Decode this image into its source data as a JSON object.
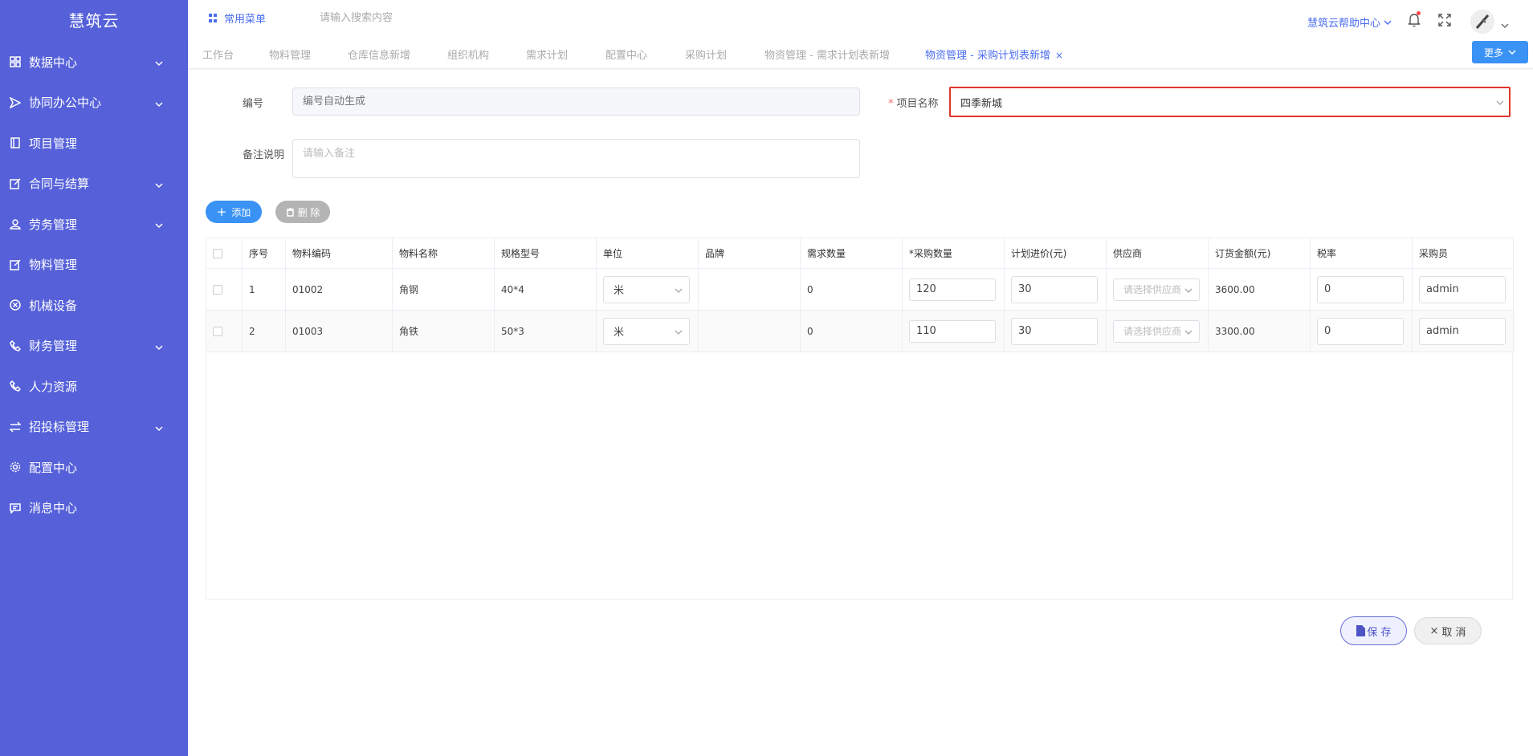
{
  "app": {
    "title": "慧筑云"
  },
  "sidebar": {
    "items": [
      {
        "label": "数据中心",
        "icon": "grid-icon",
        "expandable": true
      },
      {
        "label": "协同办公中心",
        "icon": "send-icon",
        "expandable": true
      },
      {
        "label": "项目管理",
        "icon": "book-icon",
        "expandable": false
      },
      {
        "label": "合同与结算",
        "icon": "edit-icon",
        "expandable": true
      },
      {
        "label": "劳务管理",
        "icon": "user-icon",
        "expandable": true
      },
      {
        "label": "物料管理",
        "icon": "edit-icon",
        "expandable": false
      },
      {
        "label": "机械设备",
        "icon": "circle-x-icon",
        "expandable": false
      },
      {
        "label": "财务管理",
        "icon": "phone-icon",
        "expandable": true
      },
      {
        "label": "人力资源",
        "icon": "phone-icon",
        "expandable": false
      },
      {
        "label": "招投标管理",
        "icon": "swap-icon",
        "expandable": true
      },
      {
        "label": "配置中心",
        "icon": "gear-icon",
        "expandable": false
      },
      {
        "label": "消息中心",
        "icon": "message-icon",
        "expandable": false
      }
    ]
  },
  "topbar": {
    "favorites_label": "常用菜单",
    "search_placeholder": "请输入搜索内容",
    "help_label": "慧筑云帮助中心"
  },
  "tabs": [
    {
      "label": "工作台",
      "active": false
    },
    {
      "label": "物料管理",
      "active": false
    },
    {
      "label": "仓库信息新增",
      "active": false
    },
    {
      "label": "组织机构",
      "active": false
    },
    {
      "label": "需求计划",
      "active": false
    },
    {
      "label": "配置中心",
      "active": false
    },
    {
      "label": "采购计划",
      "active": false
    },
    {
      "label": "物资管理 - 需求计划表新增",
      "active": false
    },
    {
      "label": "物资管理 - 采购计划表新增",
      "active": true
    }
  ],
  "more_label": "更多",
  "form": {
    "code_label": "编号",
    "code_placeholder": "编号自动生成",
    "project_label": "项目名称",
    "project_required_mark": "*",
    "project_value": "四季新城",
    "remark_label": "备注说明",
    "remark_placeholder": "请输入备注"
  },
  "actions": {
    "add_label": "添加",
    "delete_label": "删 除",
    "save_label": "保 存",
    "cancel_label": "取 消"
  },
  "table": {
    "columns": [
      "序号",
      "物料编码",
      "物料名称",
      "规格型号",
      "单位",
      "品牌",
      "需求数量",
      "*采购数量",
      "计划进价(元)",
      "供应商",
      "订货金额(元)",
      "税率",
      "采购员"
    ],
    "supplier_placeholder": "请选择供应商",
    "rows": [
      {
        "seq": "1",
        "code": "01002",
        "name": "角钢",
        "spec": "40*4",
        "unit": "米",
        "brand": "",
        "demand": "0",
        "qty": "120",
        "price": "30",
        "amount": "3600.00",
        "tax": "0",
        "buyer": "admin"
      },
      {
        "seq": "2",
        "code": "01003",
        "name": "角铁",
        "spec": "50*3",
        "unit": "米",
        "brand": "",
        "demand": "0",
        "qty": "110",
        "price": "30",
        "amount": "3300.00",
        "tax": "0",
        "buyer": "admin"
      }
    ]
  },
  "colors": {
    "sidebar_bg": "#5560d9",
    "accent": "#3a92f5",
    "highlight_border": "#e0352b"
  }
}
